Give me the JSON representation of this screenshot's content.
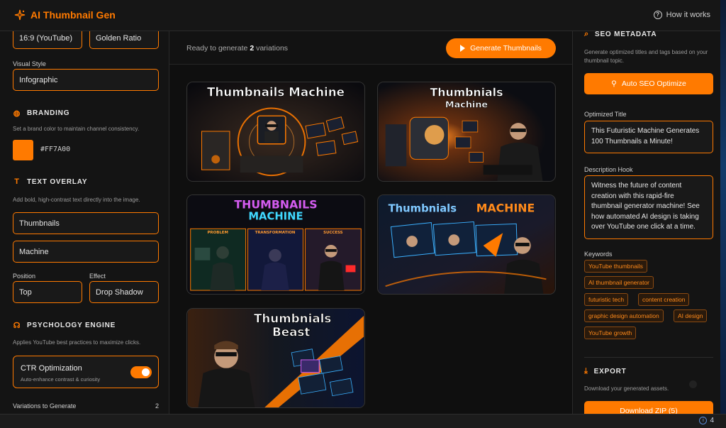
{
  "app": {
    "title": "AI Thumbnail Gen",
    "help_label": "How it works"
  },
  "left": {
    "aspect_ratio": "16:9 (YouTube)",
    "composition": "Golden Ratio",
    "visual_style_label": "Visual Style",
    "visual_style": "Infographic",
    "branding": {
      "heading": "BRANDING",
      "description": "Set a brand color to maintain channel consistency.",
      "color": "#FF7A00",
      "color_label": "#FF7A00"
    },
    "text_overlay": {
      "heading": "TEXT OVERLAY",
      "description": "Add bold, high-contrast text directly into the image.",
      "line1": "Thumbnails",
      "line2": "Machine",
      "position_label": "Position",
      "position": "Top",
      "effect_label": "Effect",
      "effect": "Drop Shadow"
    },
    "psychology": {
      "heading": "PSYCHOLOGY ENGINE",
      "description": "Applies YouTube best practices to maximize clicks.",
      "ctr_title": "CTR Optimization",
      "ctr_sub": "Auto-enhance contrast & curiosity",
      "ctr_enabled": true
    },
    "variations_label": "Variations to Generate",
    "variations_value": "2"
  },
  "main": {
    "status_prefix": "Ready to generate",
    "status_count": "2",
    "status_suffix": "variations",
    "generate_label": "Generate Thumbnails",
    "thumbnails": [
      {
        "title": "Thumbnails Machine"
      },
      {
        "title_line1": "Thumbnials",
        "title_line2": "Machine"
      },
      {
        "title_line1": "THUMBNAILS",
        "title_line2": "MACHINE",
        "panels": [
          "PROBLEM",
          "TRANSFORMATION",
          "SUCCESS"
        ]
      },
      {
        "title_part1": "Thumbnials",
        "title_part2": "MACHINE"
      },
      {
        "title_line1": "Thumbnials",
        "title_line2": "Beast"
      }
    ]
  },
  "right": {
    "seo": {
      "heading": "SEO METADATA",
      "description": "Generate optimized titles and tags based on your thumbnail topic.",
      "button": "Auto SEO Optimize",
      "title_label": "Optimized Title",
      "title": "This Futuristic Machine Generates 100 Thumbnails a Minute!",
      "hook_label": "Description Hook",
      "hook": "Witness the future of content creation with this rapid-fire thumbnail generator machine! See how automated AI design is taking over YouTube one click at a time.",
      "keywords_label": "Keywords",
      "keywords": [
        "YouTube thumbnails",
        "AI thumbnail generator",
        "futuristic tech",
        "content creation",
        "graphic design automation",
        "AI design",
        "YouTube growth"
      ]
    },
    "export": {
      "heading": "EXPORT",
      "description": "Download your generated assets.",
      "button": "Download ZIP (5)"
    }
  },
  "statusbar": {
    "count": "4"
  },
  "colors": {
    "accent": "#ff7a00",
    "background": "#121212"
  }
}
